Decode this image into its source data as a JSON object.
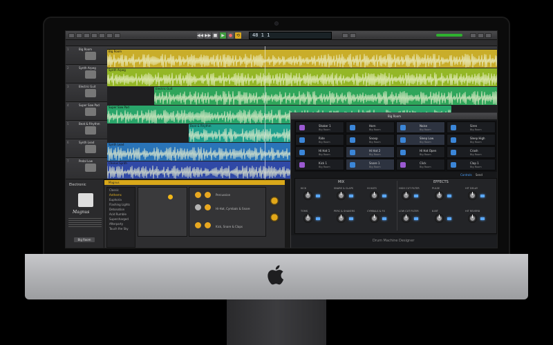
{
  "app": {
    "control_bar": {
      "lcd_text": "48 1 1",
      "transport": [
        "◀◀",
        "▶▶",
        "■",
        "▶",
        "●",
        "⟲"
      ]
    },
    "tracks": [
      {
        "num": "1",
        "name": "Big Room"
      },
      {
        "num": "2",
        "name": "Synth Arpeg"
      },
      {
        "num": "3",
        "name": "Electric Guit"
      },
      {
        "num": "4",
        "name": "Super Saw Pad"
      },
      {
        "num": "5",
        "name": "Beat & Rhythm"
      },
      {
        "num": "6",
        "name": "Synth Lead"
      },
      {
        "num": "7",
        "name": "Pedal Low"
      }
    ],
    "regions": [
      {
        "label": "Big Room",
        "color": "#c9ad2a"
      },
      {
        "label": "Synth Arpeg",
        "color": "#94b726"
      },
      {
        "label": "Electric Guit",
        "color": "#2fa55a"
      },
      {
        "label": "Super Saw Pad",
        "color": "#29a56a"
      },
      {
        "label": "Beat & Rhythm",
        "color": "#1fa08e"
      },
      {
        "label": "Synth Lead",
        "color": "#2a74b8"
      },
      {
        "label": "Chorus Synth",
        "color": "#3049a6"
      }
    ],
    "library": {
      "title": "Electronic",
      "signature": "Magnus",
      "button": "Big Room"
    },
    "drummer": {
      "title": "Magnus",
      "styles": [
        "Classic",
        "Anthems",
        "Euphoria",
        "Flashing Lights",
        "Detonation",
        "Acid Rumble",
        "Supercharged",
        "Afterparty",
        "Touch the Sky"
      ],
      "selected_style": "Anthems",
      "kit_labels": [
        "Percussion",
        "Hi-Hat, Cymbals & Snare",
        "Kick, Snare & Claps"
      ]
    },
    "dmd": {
      "kit_name": "Big Room",
      "pads": [
        {
          "name": "Shaker 1",
          "sub": "Big Room"
        },
        {
          "name": "Horn",
          "sub": "Big Room"
        },
        {
          "name": "Noise",
          "sub": "Big Room"
        },
        {
          "name": "Siren",
          "sub": "Big Room"
        },
        {
          "name": "Ride",
          "sub": "Big Room"
        },
        {
          "name": "Snoop",
          "sub": "Big Room"
        },
        {
          "name": "Sleep Low",
          "sub": "Big Room"
        },
        {
          "name": "Sleep High",
          "sub": "Big Room"
        },
        {
          "name": "Hi Hat 1",
          "sub": "Big Room"
        },
        {
          "name": "Hi Hat 2",
          "sub": "Big Room"
        },
        {
          "name": "Hi Hat Open",
          "sub": "Big Room"
        },
        {
          "name": "Crash",
          "sub": "Big Room"
        },
        {
          "name": "Kick 1",
          "sub": "Big Room"
        },
        {
          "name": "Snare 1",
          "sub": "Big Room"
        },
        {
          "name": "Click",
          "sub": "Big Room"
        },
        {
          "name": "Clap 1",
          "sub": "Big Room"
        }
      ],
      "tabs": [
        "Controls",
        "Send"
      ],
      "mix_title": "MIX",
      "effects_title": "EFFECTS",
      "mix_knobs": [
        "KICK",
        "SNARE & CLAPS",
        "HI HATS",
        "TOMS",
        "PERC & SHAKERS",
        "CYMBALS & FX"
      ],
      "effect_knobs": [
        "HIGH CUT FILTER",
        "PULSE",
        "HIT DELAY",
        "LOW CUT FILTER",
        "8-BIT",
        "HIT REVERB"
      ],
      "footer": "Drum Machine Designer"
    }
  }
}
